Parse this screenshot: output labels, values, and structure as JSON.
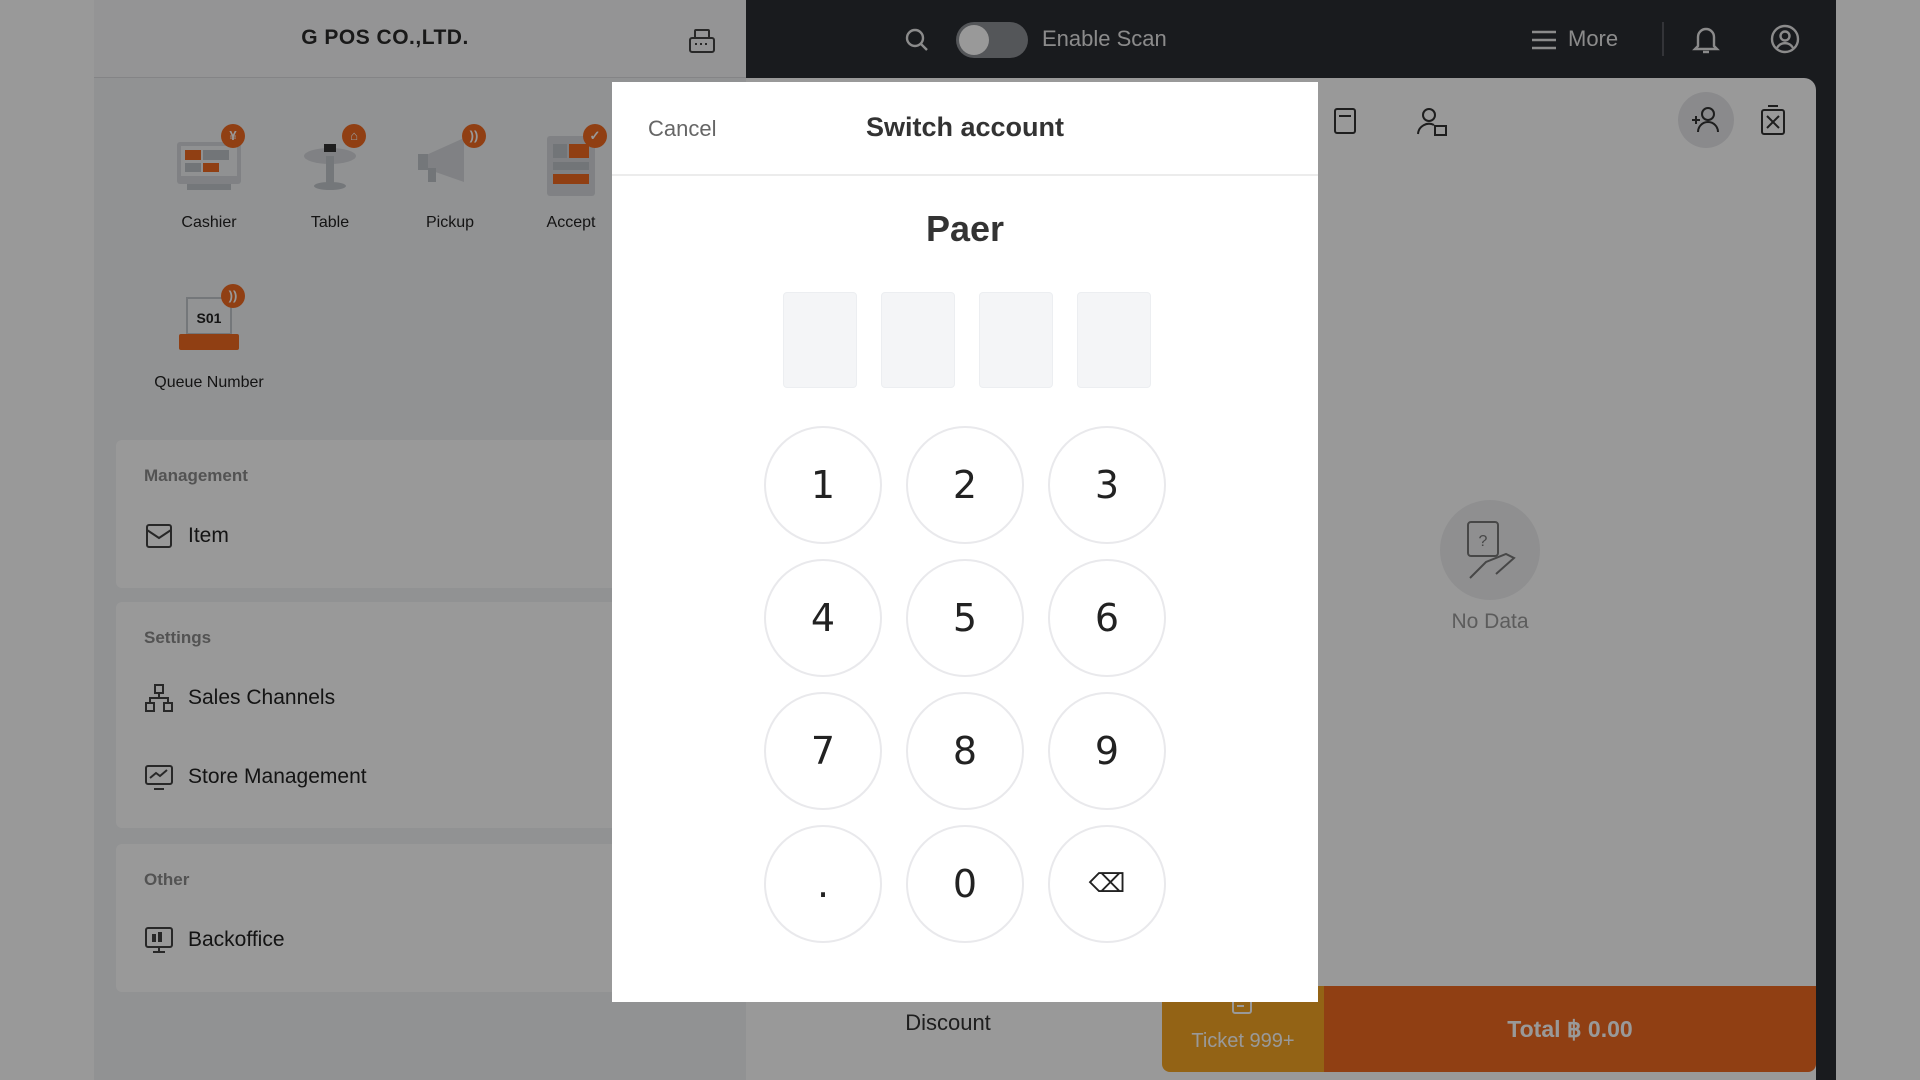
{
  "company_name": "G POS CO.,LTD.",
  "apps": [
    {
      "label": "Cashier",
      "badge": "¥",
      "icon": "cashier-icon"
    },
    {
      "label": "Table",
      "badge": "⌂",
      "icon": "table-icon"
    },
    {
      "label": "Pickup",
      "badge": "))",
      "icon": "megaphone-icon"
    },
    {
      "label": "Accept",
      "badge": "✓",
      "icon": "accept-icon"
    },
    {
      "label": "Queue Number",
      "badge": "))",
      "icon": "queue-icon",
      "ticket_text": "S01"
    }
  ],
  "sections": {
    "management": {
      "title": "Management",
      "items": [
        {
          "label": "Item",
          "icon": "item-icon"
        }
      ]
    },
    "settings": {
      "title": "Settings",
      "items": [
        {
          "label": "Sales Channels",
          "icon": "sales-channels-icon"
        },
        {
          "label": "Store Management",
          "icon": "store-management-icon"
        }
      ]
    },
    "other": {
      "title": "Other",
      "items": [
        {
          "label": "Backoffice",
          "icon": "backoffice-icon"
        }
      ]
    }
  },
  "topbar": {
    "scan_label": "Enable Scan",
    "scan_enabled": false,
    "more_label": "More"
  },
  "main": {
    "empty_label": "No Data"
  },
  "bottom": {
    "discount_label": "Discount",
    "ticket_label": "Ticket 999+",
    "total_label": "Total ฿ 0.00"
  },
  "modal": {
    "cancel_label": "Cancel",
    "title": "Switch account",
    "user_name": "Paer",
    "pin_length": 4,
    "keys": [
      "1",
      "2",
      "3",
      "4",
      "5",
      "6",
      "7",
      "8",
      "9",
      ".",
      "0",
      "⌫"
    ]
  },
  "colors": {
    "accent": "#f06a21",
    "dark": "#2a2d33",
    "background": "#f2f3f5"
  }
}
